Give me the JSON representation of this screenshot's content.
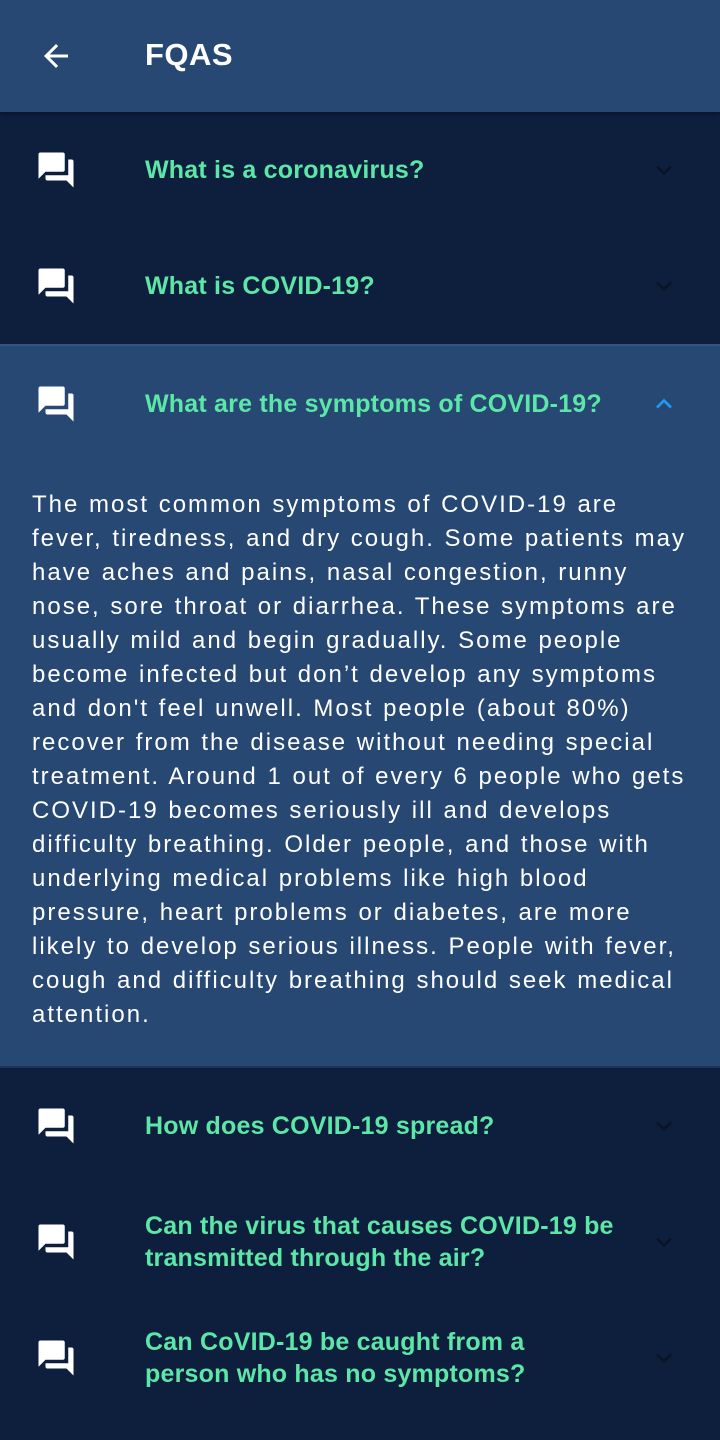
{
  "header": {
    "title": "FQAS",
    "back_icon": "arrow-back-icon"
  },
  "colors": {
    "app_bar": "#264873",
    "background": "#0e1f3d",
    "question_text": "#5ce6a8",
    "expanded_chevron": "#2196f3",
    "collapsed_chevron": "#0a1426"
  },
  "faq": {
    "item_icon": "question-answer-icon",
    "items": [
      {
        "question": "What is a coronavirus?",
        "expanded": false
      },
      {
        "question": "What is COVID-19?",
        "expanded": false
      },
      {
        "question": "What are the symptoms of COVID-19?",
        "expanded": true,
        "answer": "The most common symptoms of COVID-19 are fever, tiredness, and dry cough. Some patients may have aches and pains, nasal congestion, runny nose, sore throat or diarrhea. These symptoms are usually mild and begin gradually. Some people become infected but don’t develop any symptoms and don't feel unwell. Most people (about 80%) recover from the disease without needing special treatment. Around 1 out of every 6 people who gets COVID-19 becomes seriously ill and develops difficulty breathing. Older people, and those with underlying medical problems like high blood pressure, heart problems or diabetes, are more likely to develop serious illness. People with fever, cough and difficulty breathing should seek medical attention."
      },
      {
        "question": "How does COVID-19 spread?",
        "expanded": false
      },
      {
        "question": "Can the virus that causes COVID-19 be transmitted through the air?",
        "expanded": false
      },
      {
        "question": "Can CoVID-19 be caught from a person who has no symptoms?",
        "expanded": false
      }
    ]
  }
}
